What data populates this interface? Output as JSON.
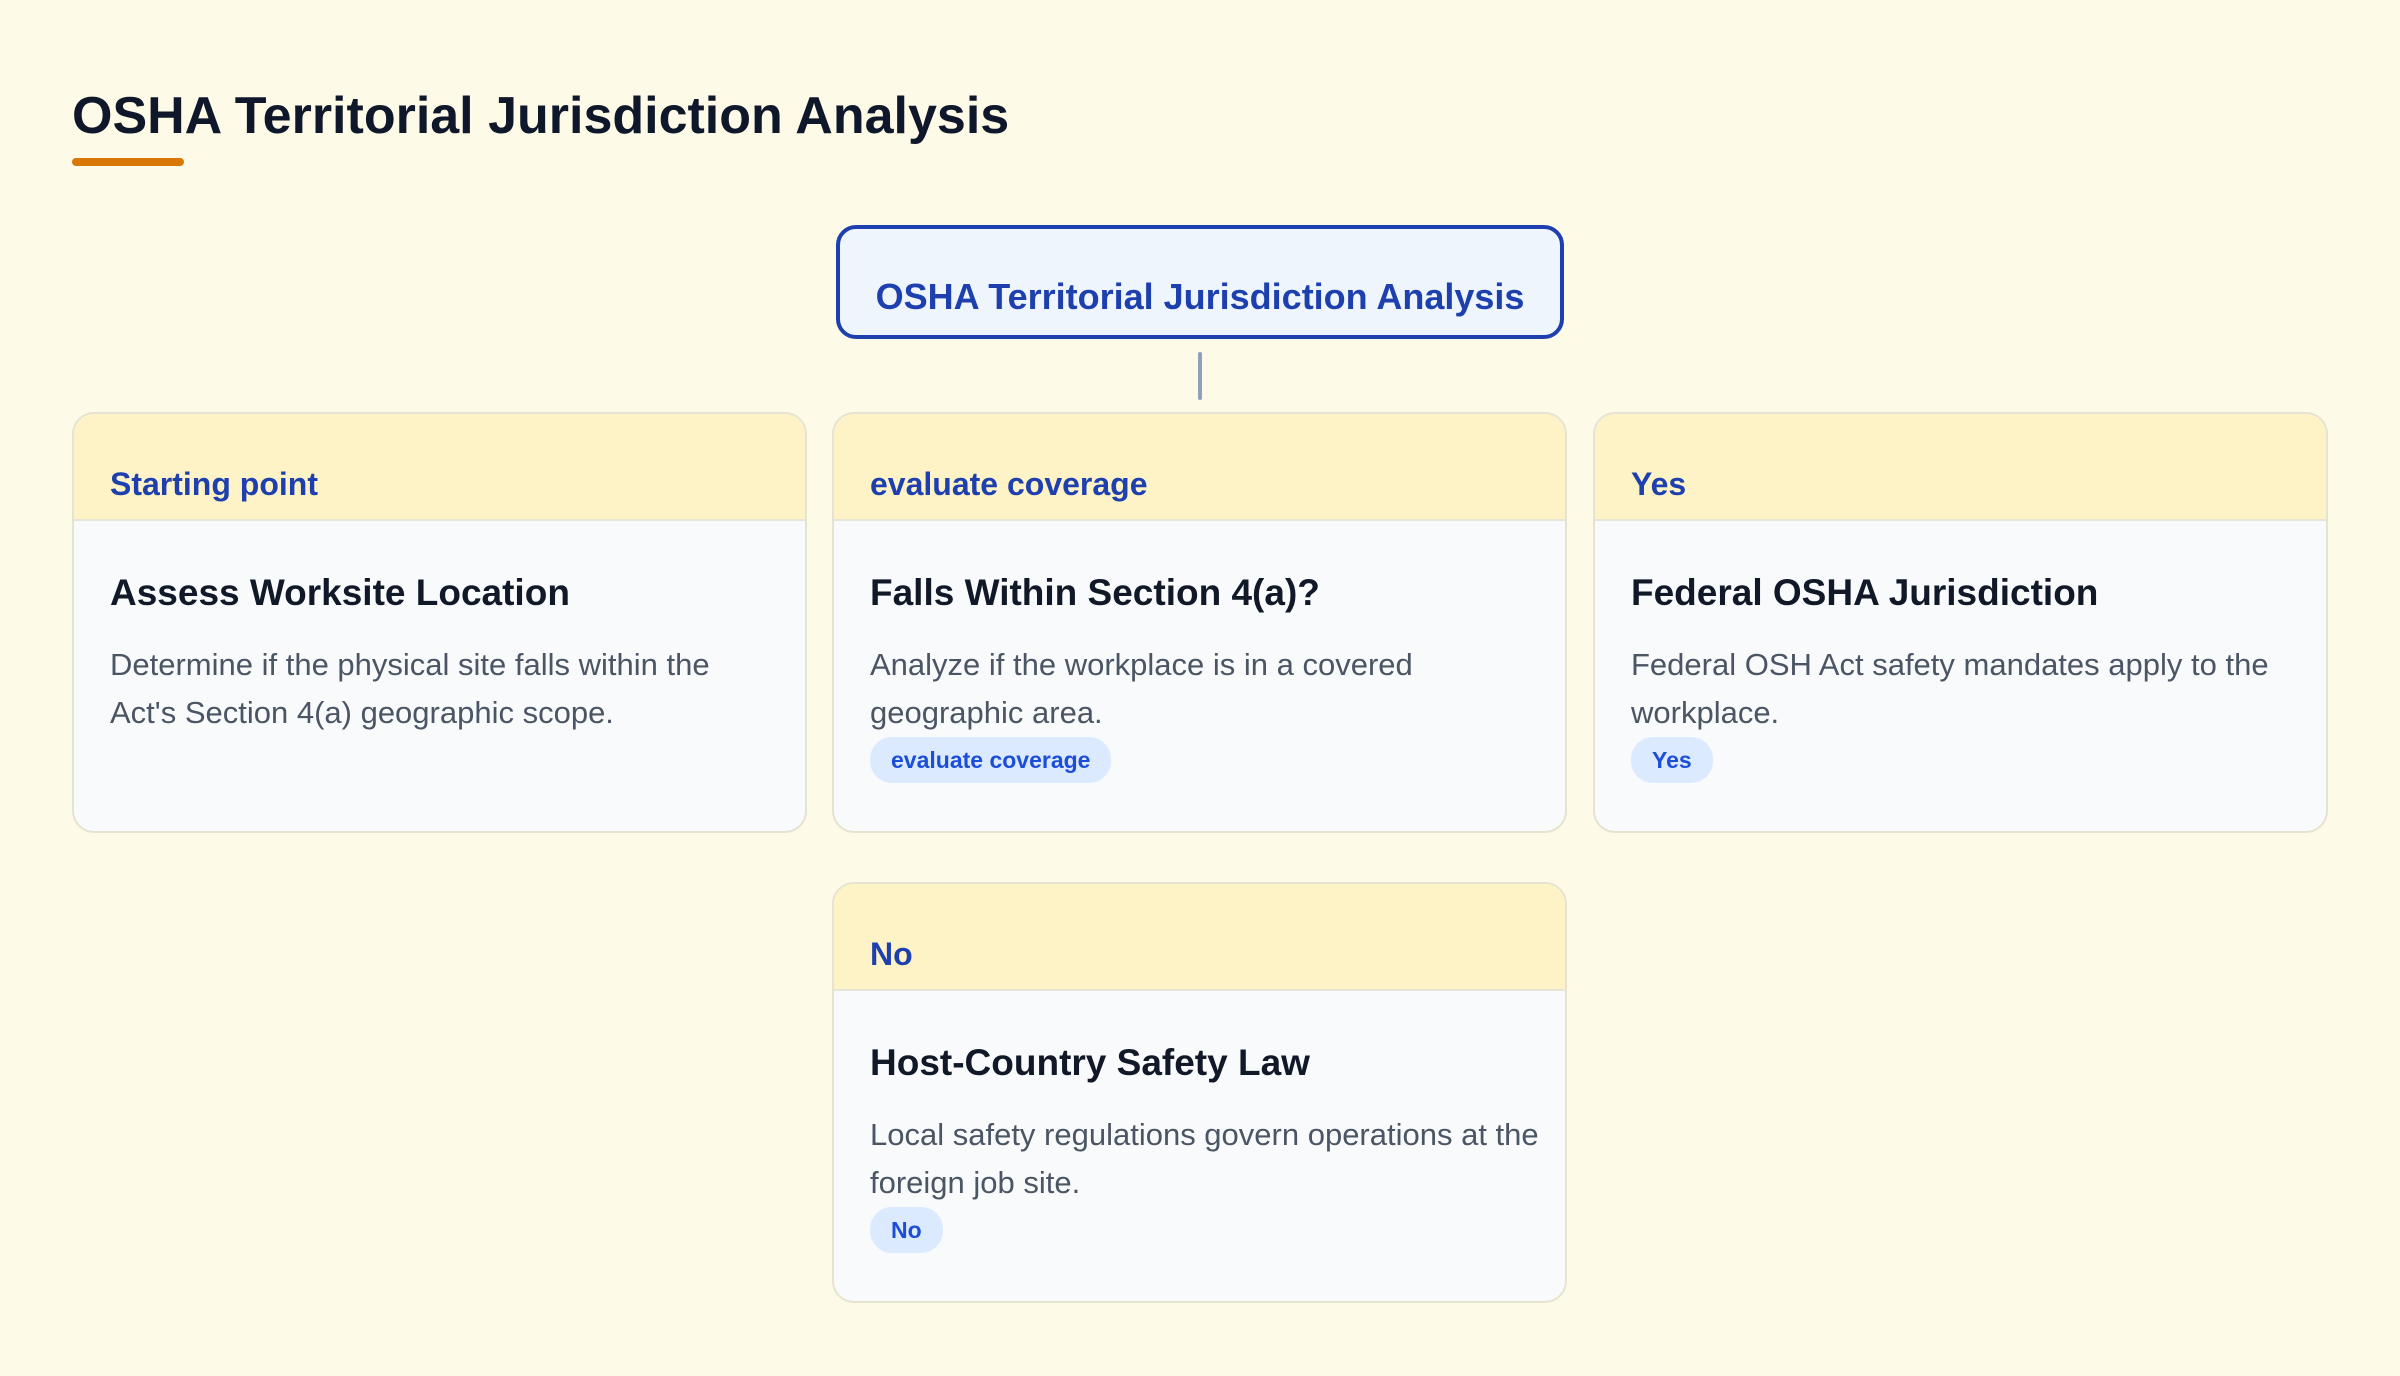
{
  "page": {
    "title": "OSHA Territorial Jurisdiction Analysis"
  },
  "root": {
    "label": "OSHA Territorial Jurisdiction Analysis"
  },
  "cards": [
    {
      "header": "Starting point",
      "title": "Assess Worksite Location",
      "description": "Determine if the physical site falls within the Act's Section 4(a) geographic scope.",
      "badge": ""
    },
    {
      "header": "evaluate coverage",
      "title": "Falls Within Section 4(a)?",
      "description": "Analyze if the workplace is in a covered geographic area.",
      "badge": "evaluate coverage"
    },
    {
      "header": "Yes",
      "title": "Federal OSHA Jurisdiction",
      "description": "Federal OSH Act safety mandates apply to the workplace.",
      "badge": "Yes"
    },
    {
      "header": "No",
      "title": "Host-Country Safety Law",
      "description": "Local safety regulations govern operations at the foreign job site.",
      "badge": "No"
    }
  ],
  "colors": {
    "background": "#fefae8",
    "accent": "#d97706",
    "primary": "#1e40af",
    "card_header": "#fef3c7",
    "badge_bg": "#dbeafe"
  }
}
